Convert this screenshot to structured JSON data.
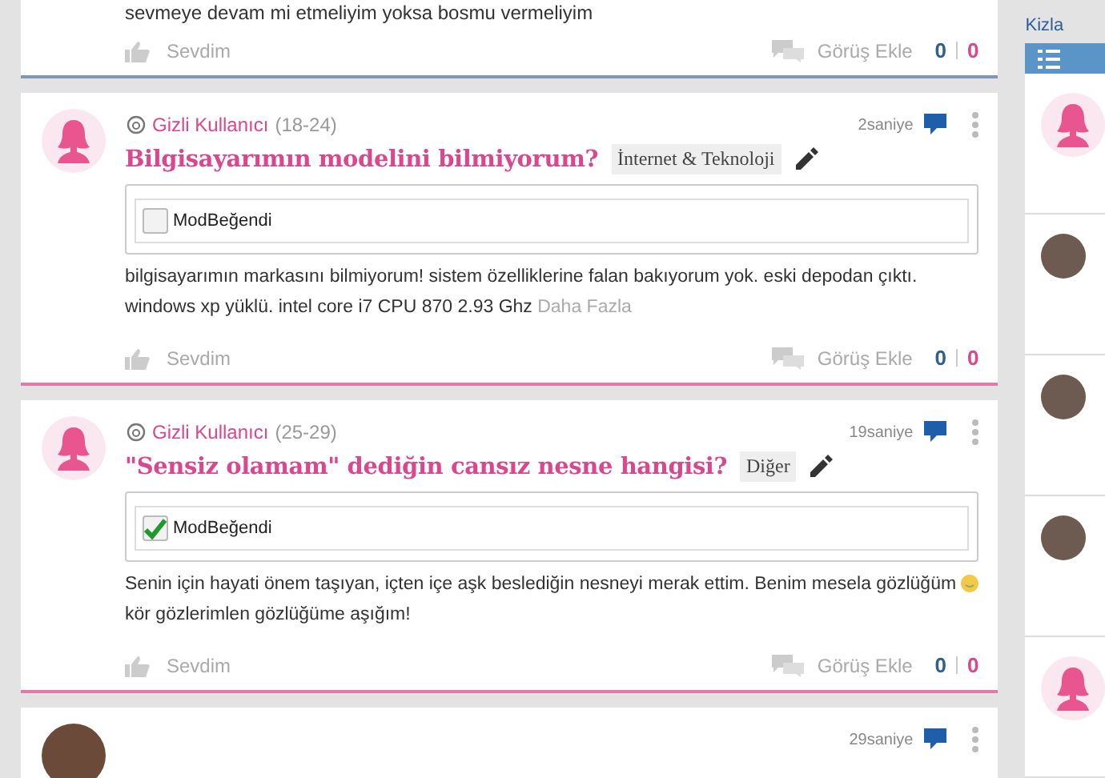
{
  "partial_post": {
    "body": "sevmeye devam mi etmeliyim yoksa bosmu vermeliyim",
    "like_label": "Sevdim",
    "comment_label": "Görüş Ekle",
    "likes": "0",
    "comments": "0"
  },
  "posts": [
    {
      "user": "Gizli Kullanıcı",
      "age": "(18-24)",
      "time": "2saniye",
      "title": "Bilgisayarımın modelini bilmiyorum?",
      "category": "İnternet & Teknoloji",
      "mod_label": "ModBeğendi",
      "mod_checked": false,
      "body_lines": [
        {
          "text": "bilgisayarımın markasını bilmiyorum! sistem özelliklerine falan bakıyorum yok. eski depodan çıktı.",
          "smiley": false
        },
        {
          "text": "windows xp yüklü. intel core i7 CPU 870 2.93 Ghz",
          "smiley": false
        }
      ],
      "more": "Daha Fazla",
      "like_label": "Sevdim",
      "comment_label": "Görüş Ekle",
      "likes": "0",
      "comments": "0"
    },
    {
      "user": "Gizli Kullanıcı",
      "age": "(25-29)",
      "time": "19saniye",
      "title": "\"Sensiz olamam\" dediğin cansız nesne hangisi?",
      "category": "Diğer",
      "mod_label": "ModBeğendi",
      "mod_checked": true,
      "body_lines": [
        {
          "text": "Senin için hayati önem taşıyan, içten içe aşk beslediğin nesneyi merak ettim. Benim mesela gözlüğüm",
          "smiley": true
        },
        {
          "text": "kör gözlerimlen gözlüğüme aşığım!",
          "smiley": false
        }
      ],
      "like_label": "Sevdim",
      "comment_label": "Görüş Ekle",
      "likes": "0",
      "comments": "0"
    }
  ],
  "next_post": {
    "time": "29saniye"
  },
  "sidebar": {
    "title": "Kizla",
    "items": [
      {
        "kind": "avatar"
      },
      {
        "kind": "photo"
      },
      {
        "kind": "photo"
      },
      {
        "kind": "photo"
      },
      {
        "kind": "avatar"
      }
    ]
  }
}
